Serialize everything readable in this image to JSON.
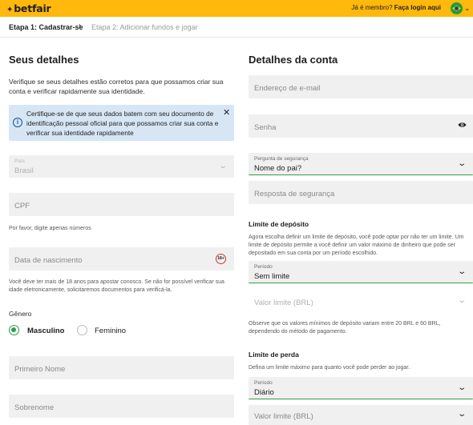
{
  "header": {
    "logo": "betfair",
    "member_prompt": "Já é membro?",
    "login_link": "Faça login aqui",
    "flag_icon": "brazil-flag-icon"
  },
  "steps": {
    "step1": "Etapa 1: Cadastrar-se",
    "step2": "Etapa 2: Adicionar fundos e jogar"
  },
  "details": {
    "title": "Seus detalhes",
    "intro": "Verifique se seus detalhes estão corretos para que possamos criar sua conta e verificar rapidamente sua identidade.",
    "info_box": "Certifique-se de que seus dados batem com seu documento de identificação pessoal oficial para que possamos criar sua conta e verificar sua identidade rapidamente",
    "country_label": "País",
    "country_value": "Brasil",
    "cpf_placeholder": "CPF",
    "cpf_hint": "Por favor, digite apenas números",
    "dob_placeholder": "Data de nascimento",
    "age_badge": "18+",
    "dob_hint": "Você deve ter mais de 18 anos para apostar conosco. Se não for possível verificar sua idade eletronicamente, solicitaremos documentos para verificá-la.",
    "gender_label": "Gênero",
    "gender_options": [
      "Masculino",
      "Feminino"
    ],
    "gender_selected": "Masculino",
    "first_name_placeholder": "Primeiro Nome",
    "surname_placeholder": "Sobrenome"
  },
  "account": {
    "title": "Detalhes da conta",
    "email_placeholder": "Endereço de e-mail",
    "password_placeholder": "Senha",
    "security_question_label": "Pergunta de segurança",
    "security_question_value": "Nome do pai?",
    "security_answer_placeholder": "Resposta de segurança",
    "deposit_limit_title": "Limite de depósito",
    "deposit_limit_text": "Agora escolha definir um limite de depósito, você pode optar por não ter um limite. Um limite de depósito permite a você definir um valor máximo de dinheiro que pode ser depositado em sua conta por um período escolhido.",
    "deposit_period_label": "Período",
    "deposit_period_value": "Sem limite",
    "deposit_amount_placeholder": "Valor limite (BRL)",
    "deposit_note": "Observe que os valores mínimos de depósito variam entre 20 BRL e 60 BRL, dependendo do método de pagamento.",
    "loss_limit_title": "Limite de perda",
    "loss_limit_text": "Defina um limite máximo para quanto você pode perder ao jogar.",
    "loss_period_label": "Período",
    "loss_period_value": "Diário",
    "loss_amount_placeholder": "Valor limite (BRL)"
  },
  "colors": {
    "brand_yellow": "#ffb80c",
    "accent_green": "#2e9e4a",
    "info_blue": "#d6e6f5"
  }
}
